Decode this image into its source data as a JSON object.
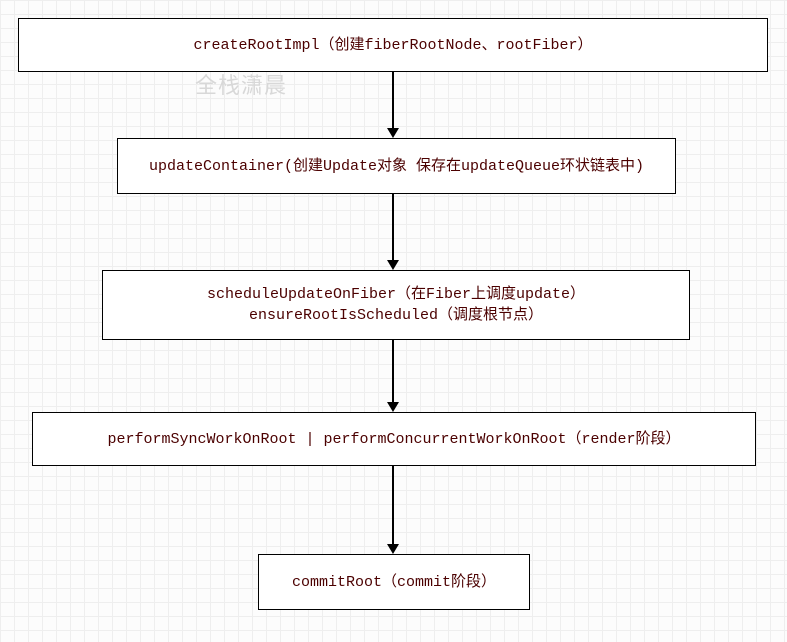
{
  "watermark": "全栈潇晨",
  "nodes": {
    "n1": {
      "label": "createRootImpl（创建fiberRootNode、rootFiber）"
    },
    "n2": {
      "label": "updateContainer(创建Update对象 保存在updateQueue环状链表中)"
    },
    "n3": {
      "line1": "scheduleUpdateOnFiber（在Fiber上调度update）",
      "line2": "ensureRootIsScheduled（调度根节点）"
    },
    "n4": {
      "label": "performSyncWorkOnRoot | performConcurrentWorkOnRoot（render阶段）"
    },
    "n5": {
      "label": "commitRoot（commit阶段）"
    }
  },
  "chart_data": {
    "type": "flowchart",
    "direction": "top-to-bottom",
    "nodes": [
      {
        "id": "n1",
        "text": "createRootImpl（创建fiberRootNode、rootFiber）"
      },
      {
        "id": "n2",
        "text": "updateContainer(创建Update对象 保存在updateQueue环状链表中)"
      },
      {
        "id": "n3",
        "text": "scheduleUpdateOnFiber（在Fiber上调度update）\nensureRootIsScheduled（调度根节点）"
      },
      {
        "id": "n4",
        "text": "performSyncWorkOnRoot | performConcurrentWorkOnRoot（render阶段）"
      },
      {
        "id": "n5",
        "text": "commitRoot（commit阶段）"
      }
    ],
    "edges": [
      {
        "from": "n1",
        "to": "n2"
      },
      {
        "from": "n2",
        "to": "n3"
      },
      {
        "from": "n3",
        "to": "n4"
      },
      {
        "from": "n4",
        "to": "n5"
      }
    ]
  }
}
